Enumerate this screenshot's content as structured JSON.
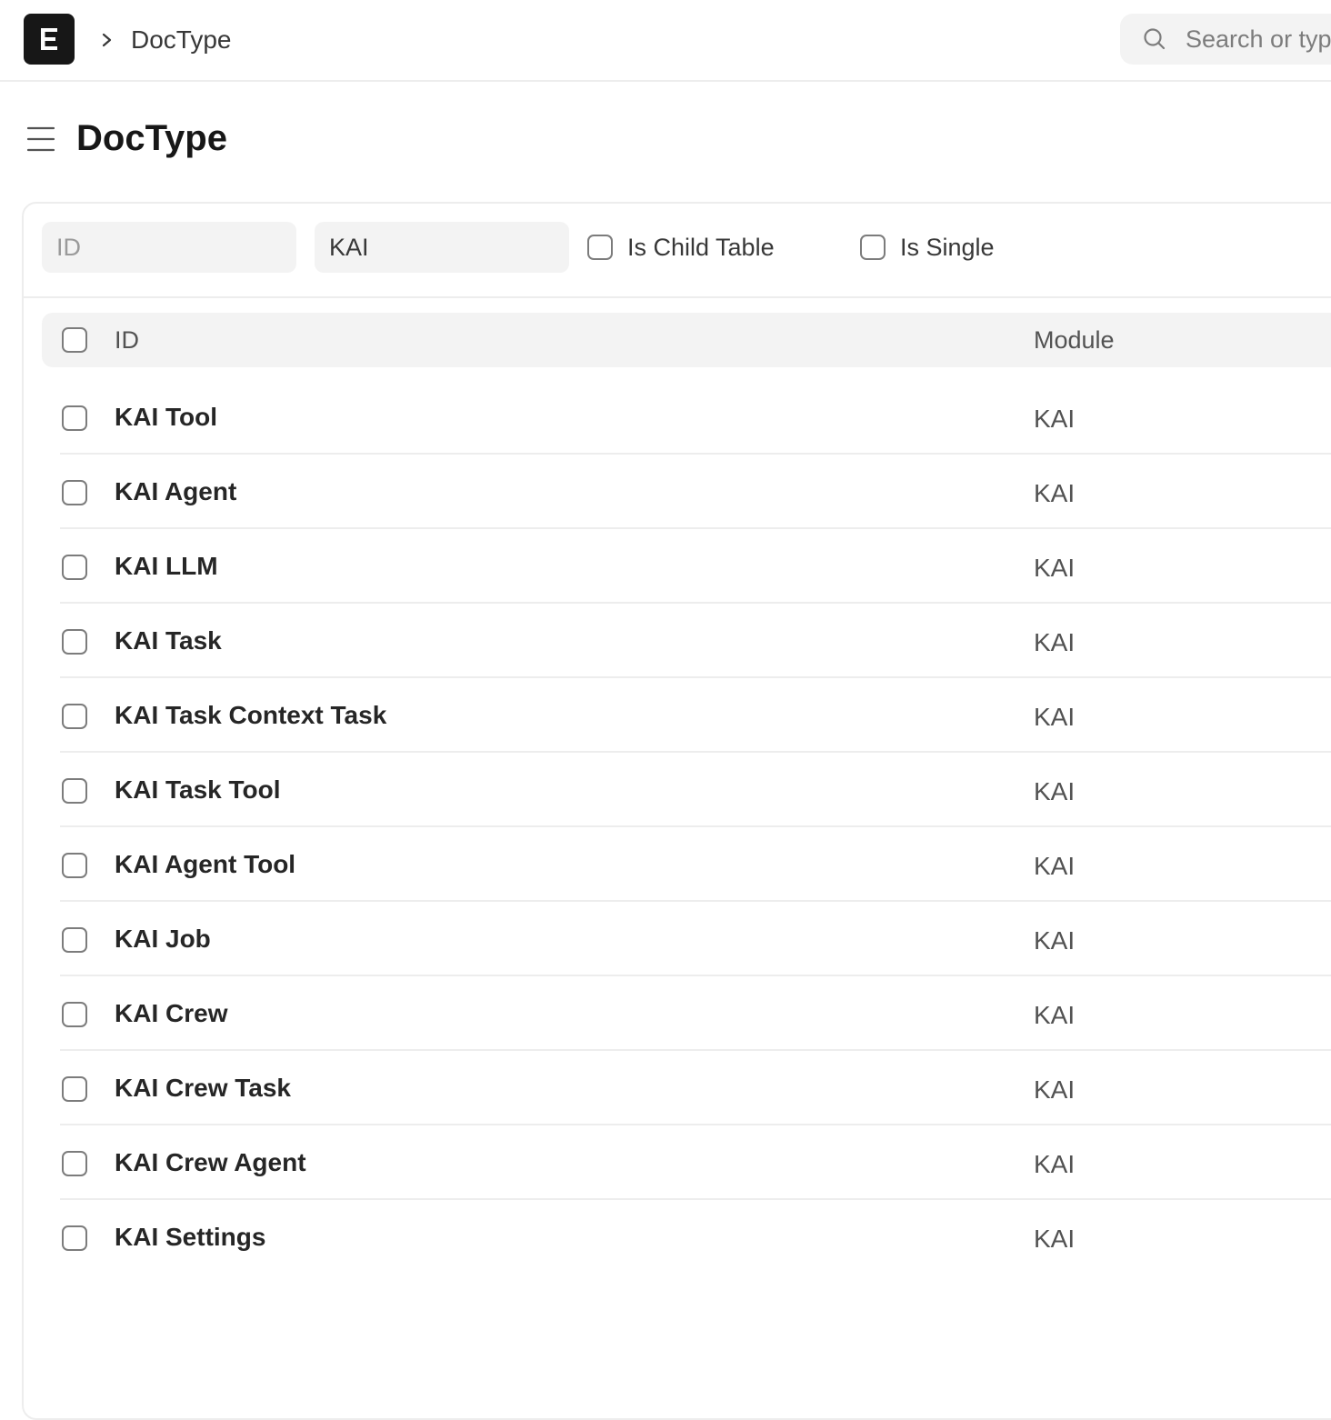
{
  "navbar": {
    "logo_letter": "E",
    "breadcrumb": "DocType",
    "search_placeholder": "Search or type a command (Ctrl + G)"
  },
  "page": {
    "title": "DocType"
  },
  "filters": {
    "id_placeholder": "ID",
    "module_value": "KAI",
    "is_child_table_label": "Is Child Table",
    "is_single_label": "Is Single"
  },
  "table": {
    "columns": {
      "id": "ID",
      "module": "Module"
    },
    "rows": [
      {
        "id": "KAI Tool",
        "module": "KAI"
      },
      {
        "id": "KAI Agent",
        "module": "KAI"
      },
      {
        "id": "KAI LLM",
        "module": "KAI"
      },
      {
        "id": "KAI Task",
        "module": "KAI"
      },
      {
        "id": "KAI Task Context Task",
        "module": "KAI"
      },
      {
        "id": "KAI Task Tool",
        "module": "KAI"
      },
      {
        "id": "KAI Agent Tool",
        "module": "KAI"
      },
      {
        "id": "KAI Job",
        "module": "KAI"
      },
      {
        "id": "KAI Crew",
        "module": "KAI"
      },
      {
        "id": "KAI Crew Task",
        "module": "KAI"
      },
      {
        "id": "KAI Crew Agent",
        "module": "KAI"
      },
      {
        "id": "KAI Settings",
        "module": "KAI"
      }
    ]
  },
  "icons": {
    "logo": "frappe-logo-icon",
    "breadcrumb_separator": "chevron-right-icon",
    "search": "search-icon",
    "sidebar_toggle": "menu-icon"
  },
  "colors": {
    "logo_bg": "#171717",
    "input_bg": "#f3f3f3",
    "border": "#ededed",
    "text_primary": "#171717",
    "text_muted": "#525252"
  }
}
